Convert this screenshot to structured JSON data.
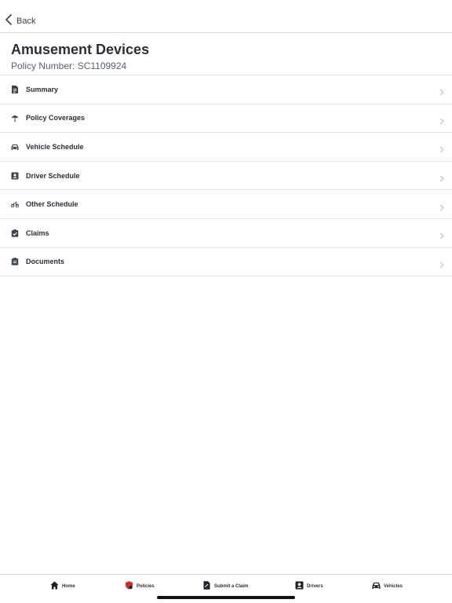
{
  "nav": {
    "back_label": "Back"
  },
  "header": {
    "title": "Amusement Devices",
    "policy_number": "Policy Number: SC1109924"
  },
  "menu": {
    "items": [
      {
        "label": "Summary",
        "icon": "summary-icon"
      },
      {
        "label": "Policy Coverages",
        "icon": "umbrella-icon"
      },
      {
        "label": "Vehicle Schedule",
        "icon": "car-icon"
      },
      {
        "label": "Driver Schedule",
        "icon": "id-card-icon"
      },
      {
        "label": "Other Schedule",
        "icon": "motorcycle-icon"
      },
      {
        "label": "Claims",
        "icon": "clipboard-check-icon"
      },
      {
        "label": "Documents",
        "icon": "clipboard-list-icon"
      }
    ]
  },
  "tabs": [
    {
      "label": "Home",
      "icon": "home-icon"
    },
    {
      "label": "Policies",
      "icon": "shield-icon",
      "accent": "#d62b2b"
    },
    {
      "label": "Submit a Claim",
      "icon": "claim-doc-icon"
    },
    {
      "label": "Drivers",
      "icon": "id-card-icon"
    },
    {
      "label": "Vehicles",
      "icon": "car-icon"
    }
  ],
  "colors": {
    "text": "#2b2f36",
    "icon": "#3d4450",
    "divider": "#e3e5e8",
    "accent": "#d62b2b"
  }
}
